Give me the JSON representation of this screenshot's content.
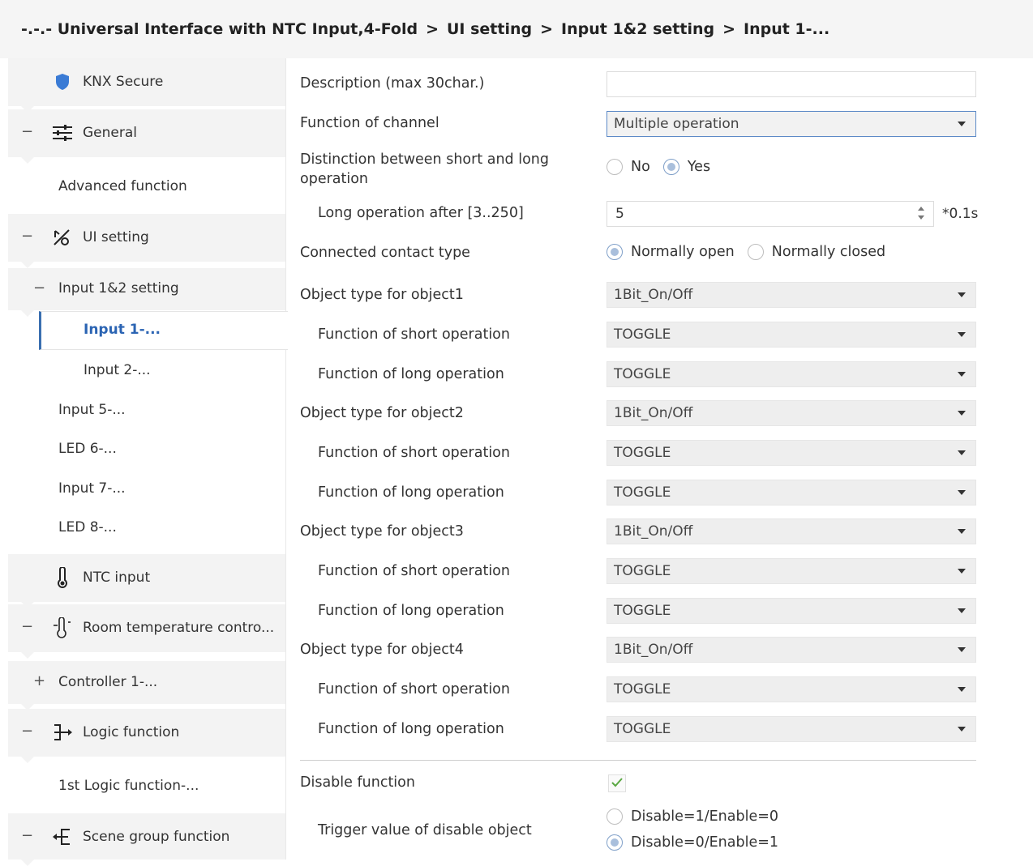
{
  "breadcrumb": {
    "parts": [
      "-.-.- Universal Interface with NTC Input,4-Fold",
      "UI setting",
      "Input 1&2 setting",
      "Input 1-..."
    ],
    "separator": ">"
  },
  "sidebar": {
    "items": [
      {
        "label": "KNX Secure",
        "icon": "shield-icon"
      },
      {
        "label": "General",
        "icon": "sliders-icon",
        "expander": "−"
      },
      {
        "label": "Advanced function"
      },
      {
        "label": "UI setting",
        "icon": "ui-setting-icon",
        "expander": "−"
      },
      {
        "label": "Input 1&2 setting",
        "expander": "−"
      },
      {
        "label": "Input 1-..."
      },
      {
        "label": "Input 2-..."
      },
      {
        "label": "Input 5-..."
      },
      {
        "label": "LED 6-..."
      },
      {
        "label": "Input 7-..."
      },
      {
        "label": "LED 8-..."
      },
      {
        "label": "NTC input",
        "icon": "thermometer-icon"
      },
      {
        "label": "Room temperature contro...",
        "icon": "room-temperature-icon",
        "expander": "−"
      },
      {
        "label": "Controller 1-...",
        "expander": "+"
      },
      {
        "label": "Logic function",
        "icon": "logic-icon",
        "expander": "−"
      },
      {
        "label": "1st Logic function-..."
      },
      {
        "label": "Scene group function",
        "icon": "scene-group-icon",
        "expander": "−"
      }
    ]
  },
  "form": {
    "description_label": "Description (max 30char.)",
    "description_value": "",
    "function_of_channel_label": "Function of channel",
    "function_of_channel_value": "Multiple operation",
    "distinction_label": "Distinction between short and long operation",
    "distinction_options": [
      "No",
      "Yes"
    ],
    "distinction_selected": "Yes",
    "long_op_label": "Long operation after [3..250]",
    "long_op_value": "5",
    "long_op_unit": "*0.1s",
    "contact_type_label": "Connected contact type",
    "contact_type_options": [
      "Normally open",
      "Normally closed"
    ],
    "contact_type_selected": "Normally open",
    "objects": [
      {
        "type_label": "Object type for object1",
        "type_value": "1Bit_On/Off",
        "short_label": "Function of short operation",
        "short_value": "TOGGLE",
        "long_label": "Function of long operation",
        "long_value": "TOGGLE"
      },
      {
        "type_label": "Object type for object2",
        "type_value": "1Bit_On/Off",
        "short_label": "Function of short operation",
        "short_value": "TOGGLE",
        "long_label": "Function of long operation",
        "long_value": "TOGGLE"
      },
      {
        "type_label": "Object type for object3",
        "type_value": "1Bit_On/Off",
        "short_label": "Function of short operation",
        "short_value": "TOGGLE",
        "long_label": "Function of long operation",
        "long_value": "TOGGLE"
      },
      {
        "type_label": "Object type for object4",
        "type_value": "1Bit_On/Off",
        "short_label": "Function of short operation",
        "short_value": "TOGGLE",
        "long_label": "Function of long operation",
        "long_value": "TOGGLE"
      }
    ],
    "disable_label": "Disable function",
    "disable_checked": true,
    "trigger_label": "Trigger value of disable object",
    "trigger_options": [
      "Disable=1/Enable=0",
      "Disable=0/Enable=1"
    ],
    "trigger_selected": "Disable=0/Enable=1"
  },
  "colors": {
    "accent": "#2b64b3",
    "shield": "#3a7bd5",
    "check": "#5aa843"
  }
}
